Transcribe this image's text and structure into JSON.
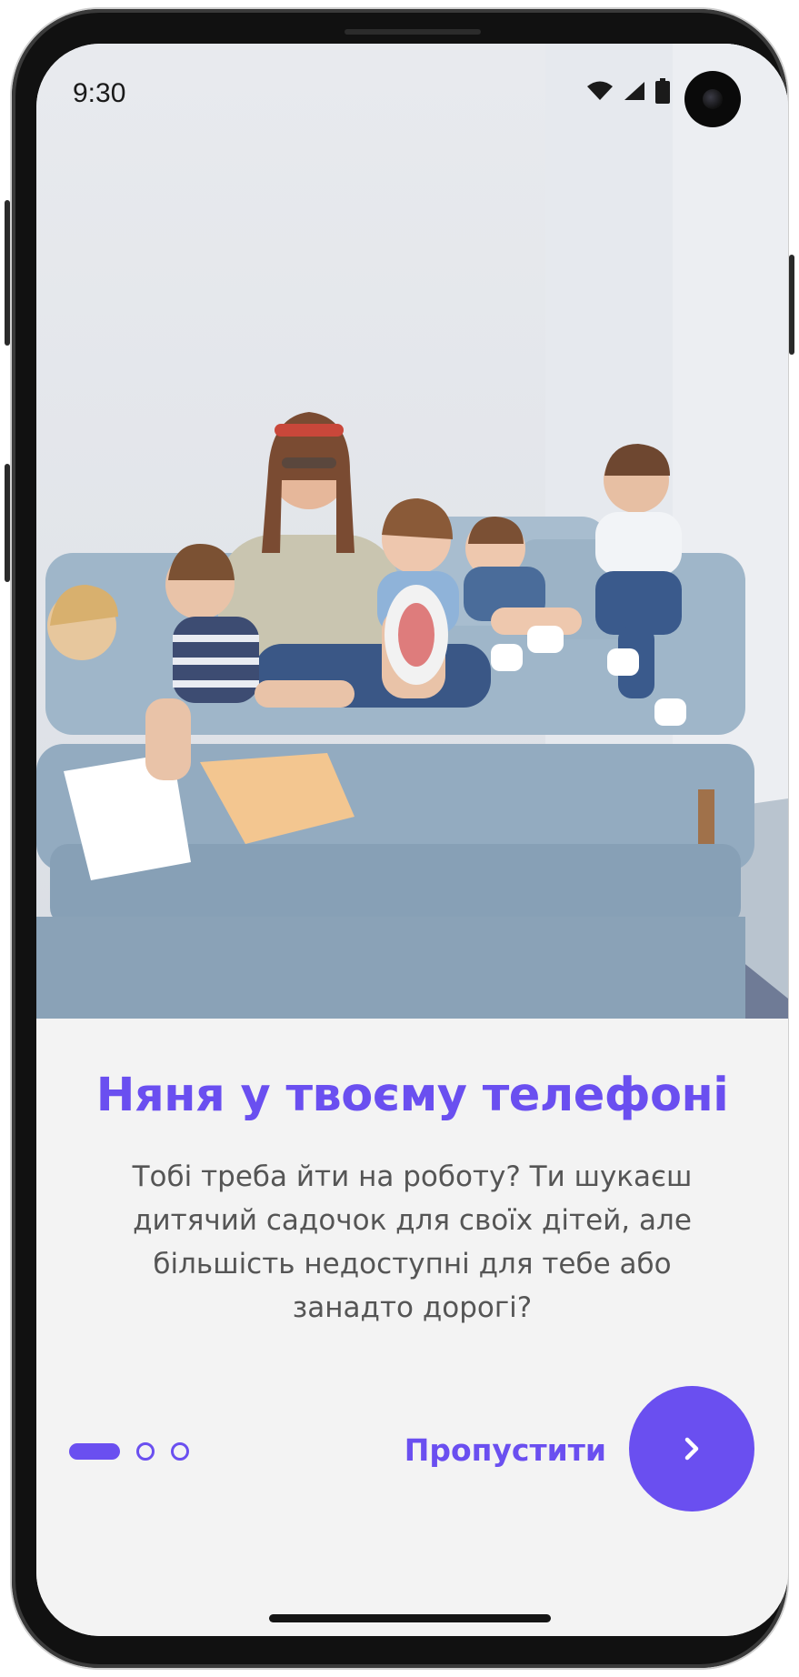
{
  "status_bar": {
    "time": "9:30",
    "icons": [
      "wifi-icon",
      "signal-icon",
      "battery-icon"
    ]
  },
  "hero": {
    "image_name": "nanny-with-children-on-sofa"
  },
  "onboarding": {
    "title": "Няня у твоєму телефоні",
    "description": "Тобі треба йти на роботу? Ти шукаєш дитячий садочок для своїх дітей, але більшість недоступні для тебе або занадто дорогі?",
    "skip_label": "Пропустити",
    "next_icon": "chevron-right-icon",
    "pager": {
      "total": 3,
      "active": 1
    }
  },
  "colors": {
    "accent": "#6a4ff0",
    "background": "#f3f3f3",
    "text": "#555555"
  }
}
